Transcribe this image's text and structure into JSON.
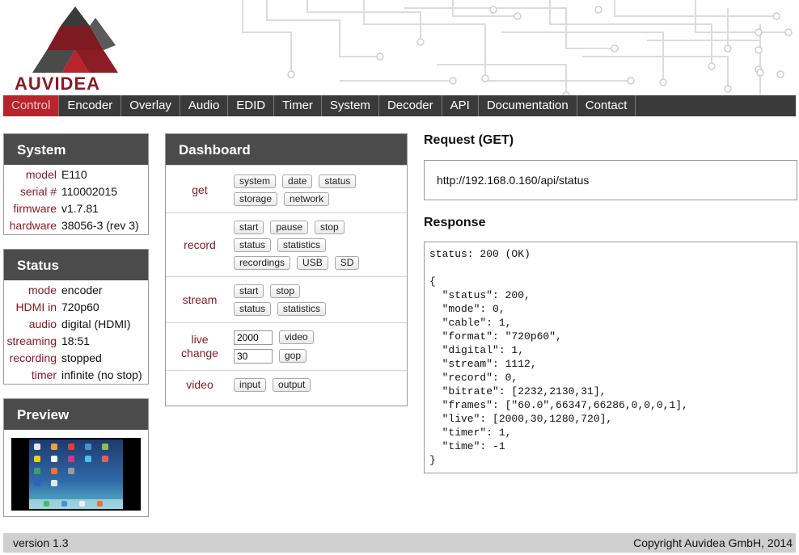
{
  "brand": {
    "name": "AUVIDEA"
  },
  "nav": [
    {
      "label": "Control",
      "active": true
    },
    {
      "label": "Encoder"
    },
    {
      "label": "Overlay"
    },
    {
      "label": "Audio"
    },
    {
      "label": "EDID"
    },
    {
      "label": "Timer"
    },
    {
      "label": "System"
    },
    {
      "label": "Decoder"
    },
    {
      "label": "API"
    },
    {
      "label": "Documentation"
    },
    {
      "label": "Contact"
    }
  ],
  "system": {
    "title": "System",
    "rows": [
      {
        "key": "model",
        "value": "E110"
      },
      {
        "key": "serial #",
        "value": "110002015"
      },
      {
        "key": "firmware",
        "value": "v1.7.81"
      },
      {
        "key": "hardware",
        "value": "38056-3 (rev 3)"
      }
    ]
  },
  "status": {
    "title": "Status",
    "rows": [
      {
        "key": "mode",
        "value": "encoder"
      },
      {
        "key": "HDMI in",
        "value": "720p60"
      },
      {
        "key": "audio",
        "value": "digital (HDMI)"
      },
      {
        "key": "streaming",
        "value": "18:51"
      },
      {
        "key": "recording",
        "value": "stopped"
      },
      {
        "key": "timer",
        "value": "infinite (no stop)"
      }
    ]
  },
  "preview": {
    "title": "Preview"
  },
  "dashboard": {
    "title": "Dashboard",
    "get": {
      "label": "get",
      "buttons": [
        "system",
        "date",
        "status",
        "storage",
        "network"
      ]
    },
    "record": {
      "label": "record",
      "buttons": [
        "start",
        "pause",
        "stop",
        "status",
        "statistics",
        "recordings",
        "USB",
        "SD"
      ]
    },
    "stream": {
      "label": "stream",
      "buttons": [
        "start",
        "stop",
        "status",
        "statistics"
      ]
    },
    "live": {
      "label_line1": "live",
      "label_line2": "change",
      "video_value": "2000",
      "video_button": "video",
      "gop_value": "30",
      "gop_button": "gop"
    },
    "video": {
      "label": "video",
      "buttons": [
        "input",
        "output"
      ]
    }
  },
  "request": {
    "title": "Request (GET)",
    "url": "http://192.168.0.160/api/status"
  },
  "response": {
    "title": "Response",
    "body": "status: 200 (OK)\n\n{\n  \"status\": 200,\n  \"mode\": 0,\n  \"cable\": 1,\n  \"format\": \"720p60\",\n  \"digital\": 1,\n  \"stream\": 1112,\n  \"record\": 0,\n  \"bitrate\": [2232,2130,31],\n  \"frames\": [\"60.0\",66347,66286,0,0,0,1],\n  \"live\": [2000,30,1280,720],\n  \"timer\": 1,\n  \"time\": -1\n}"
  },
  "footer": {
    "version": "version 1.3",
    "copyright": "Copyright Auvidea GmbH, 2014"
  },
  "colors": {
    "accent": "#8a1a24",
    "nav_bg": "#3a3a3a",
    "nav_active": "#b8242c",
    "box_head": "#4b4b4b"
  }
}
